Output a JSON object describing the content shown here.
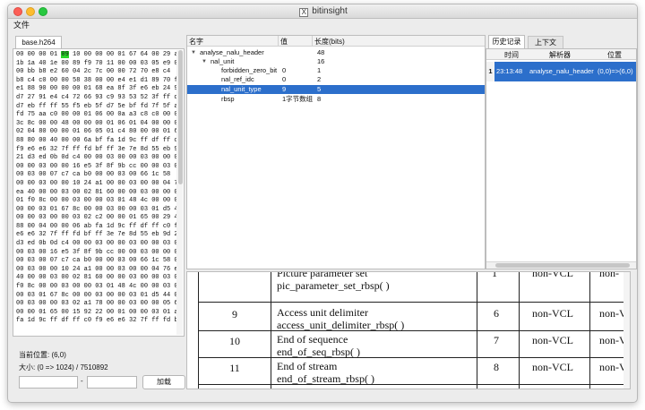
{
  "window": {
    "title": "bitinsight",
    "title_icon": "X"
  },
  "menu": {
    "file": "文件"
  },
  "hex": {
    "tab_label": "base.h264",
    "pre": "00 00 00 01 ",
    "highlight": "09",
    "post": " 10 00 00 00 01 67 64 00 29 ac\n1b 1a 40 1e 00 89 f9 70 11 00 00 03 05 e9 00\n00 bb b8 e2 60 04 2c 7c 00 00 72 70 e8 c4\nb8 c4 c0 00 00 58 38 00 00 e4 e1 d1 89 70 f8\ne1 88 90 00 00 00 01 68 ea 8f 3f e6 eb 24 9f\nd7 27 91 e4 c4 72 66 93 c9 93 53 52 3f ff d7\nd7 eb ff ff 55 f5 eb 5f d7 5e bf fd 7f 5f af\nfd 75 aa c0 00 00 01 06 00 0a a3 c8 c0 00 02\n3c 8c 00 00 48 00 00 00 01 06 01 04 00 00 03\n02 04 80 00 00 01 06 05 01 c4 80 00 00 01 65\n88 80 00 40 00 00 6a bf fa 1d 9c ff df ff c0\nf9 e6 e6 32 7f ff fd bf ff 3e 7e 8d 55 eb 9d\n21 d3 ed 0b 0d c4 00 00 03 00 00 03 00 00 03\n00 00 03 00 00 16 e5 3f 8f 9b cc 00 00 03 00\n00 03 00 07 c7 ca b0 00 00 03 00 66 1c 58\n00 00 03 00 00 10 24 a1 00 00 03 00 00 04 76\nea 40 00 00 03 00 02 81 60 00 00 03 00 00 03\n01 f0 8c 00 00 03 00 00 03 01 48 4c 00 00 03\n00 00 03 01 67 8c 00 00 03 00 00 03 01 d5 44\n00 00 03 00 00 03 02 c2 00 00 01 65 00 29 48\n88 00 04 00 00 06 ab fa 1d 9c ff df ff c0 f9\ne6 e6 32 7f ff fd bf ff 3e 7e 8d 55 eb 9d 21\nd3 ed 0b 0d c4 00 00 03 00 00 03 00 00 03 00\n00 03 00 16 e5 3f 8f 9b cc 00 00 03 00 00 03\n00 03 00 07 c7 ca b0 00 00 03 00 66 1c 58 00\n00 03 00 00 10 24 a1 00 00 03 00 00 04 76 ea\n40 00 00 03 00 02 81 60 00 00 03 00 00 03 01\nf0 8c 00 00 03 00 00 03 01 48 4c 00 00 03 00\n00 03 01 67 8c 00 00 03 00 00 03 01 d5 44 00\n00 03 00 00 03 02 a1 78 00 00 03 00 00 05 6c\n00 00 01 65 00 15 92 22 00 01 00 00 03 01 aa\nfa 1d 9c ff df ff c0 f9 e6 e6 32 7f ff fd bf"
  },
  "status": {
    "position_label": "当前位置: (6,0)",
    "size_label": "大小: (0 => 1024) / 7510892"
  },
  "range": {
    "start": "",
    "separator": "-",
    "end": "",
    "load_label": "加载"
  },
  "tree": {
    "headers": {
      "name": "名字",
      "value": "值",
      "length": "长度(bits)"
    },
    "rows": [
      {
        "name": "analyse_nalu_header",
        "value": "",
        "length": "48"
      },
      {
        "name": "nal_unit",
        "value": "",
        "length": "16"
      },
      {
        "name": "forbidden_zero_bit",
        "value": "0",
        "length": "1"
      },
      {
        "name": "nal_ref_idc",
        "value": "0",
        "length": "2"
      },
      {
        "name": "nal_unit_type",
        "value": "9",
        "length": "5"
      },
      {
        "name": "rbsp",
        "value": "1字节数组",
        "length": "8"
      }
    ],
    "selected_index": 4
  },
  "history": {
    "tab_active": "历史记录",
    "tab_other": "上下文",
    "headers": {
      "time": "时间",
      "parser": "解析器",
      "position": "位置"
    },
    "rows": [
      {
        "num": "1",
        "time": "23:13:48",
        "parser": "analyse_nalu_header",
        "position": "(0,0)=>(6,0)"
      }
    ]
  },
  "doc": {
    "partial_top_left": "Picture parameter set",
    "partial_top_code": "pic_parameter_set_rbsp( )",
    "partial_top_num": "1",
    "partial_top_type": "non-VCL",
    "partial_top_type2": "non-",
    "rows": [
      {
        "num": "9",
        "name": "Access unit delimiter",
        "code": "access_unit_delimiter_rbsp( )",
        "c": "6",
        "type": "non-VCL",
        "type2": "non-V"
      },
      {
        "num": "10",
        "name": "End of sequence",
        "code": "end_of_seq_rbsp( )",
        "c": "7",
        "type": "non-VCL",
        "type2": "non-V"
      },
      {
        "num": "11",
        "name": "End of stream",
        "code": "end_of_stream_rbsp( )",
        "c": "8",
        "type": "non-VCL",
        "type2": "non-V"
      }
    ]
  }
}
